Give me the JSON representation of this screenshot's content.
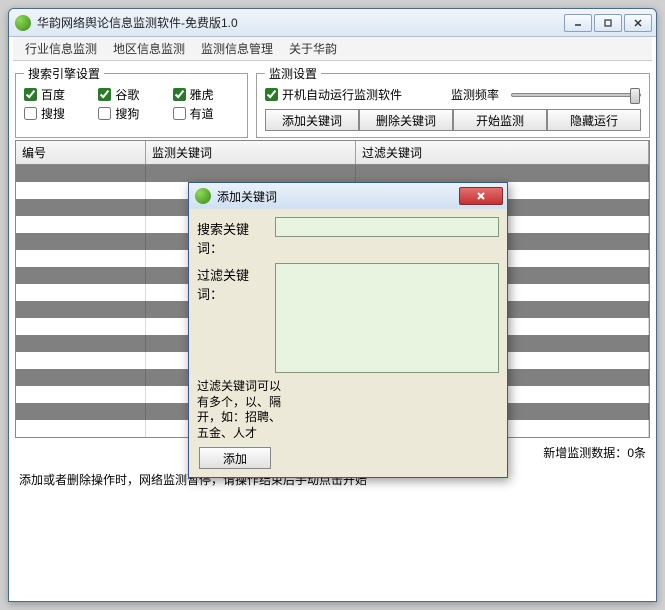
{
  "window": {
    "title": "华韵网络舆论信息监测软件-免费版1.0"
  },
  "menu": {
    "items": [
      "行业信息监测",
      "地区信息监测",
      "监测信息管理",
      "关于华韵"
    ]
  },
  "searchEngine": {
    "legend": "搜索引擎设置",
    "options": [
      {
        "label": "百度",
        "checked": true
      },
      {
        "label": "谷歌",
        "checked": true
      },
      {
        "label": "雅虎",
        "checked": true
      },
      {
        "label": "搜搜",
        "checked": false
      },
      {
        "label": "搜狗",
        "checked": false
      },
      {
        "label": "有道",
        "checked": false
      }
    ]
  },
  "monitor": {
    "legend": "监测设置",
    "autostart_label": "开机自动运行监测软件",
    "autostart_checked": true,
    "freq_label": "监测频率"
  },
  "actions": {
    "add": "添加关键词",
    "delete": "删除关键词",
    "start": "开始监测",
    "hide": "隐藏运行"
  },
  "table": {
    "headers": [
      "编号",
      "监测关键词",
      "过滤关键词"
    ]
  },
  "status": {
    "new_data_label": "新增监测数据：",
    "new_data_value": "0条"
  },
  "tip": "添加或者删除操作时，网络监测暂停，请操作结束后手动点击开始",
  "dialog": {
    "title": "添加关键词",
    "search_label": "搜索关键词：",
    "filter_label": "过滤关键词：",
    "hint": "过滤关键词可以有多个，以、隔开，如：招聘、五金、人才",
    "add_btn": "添加"
  }
}
